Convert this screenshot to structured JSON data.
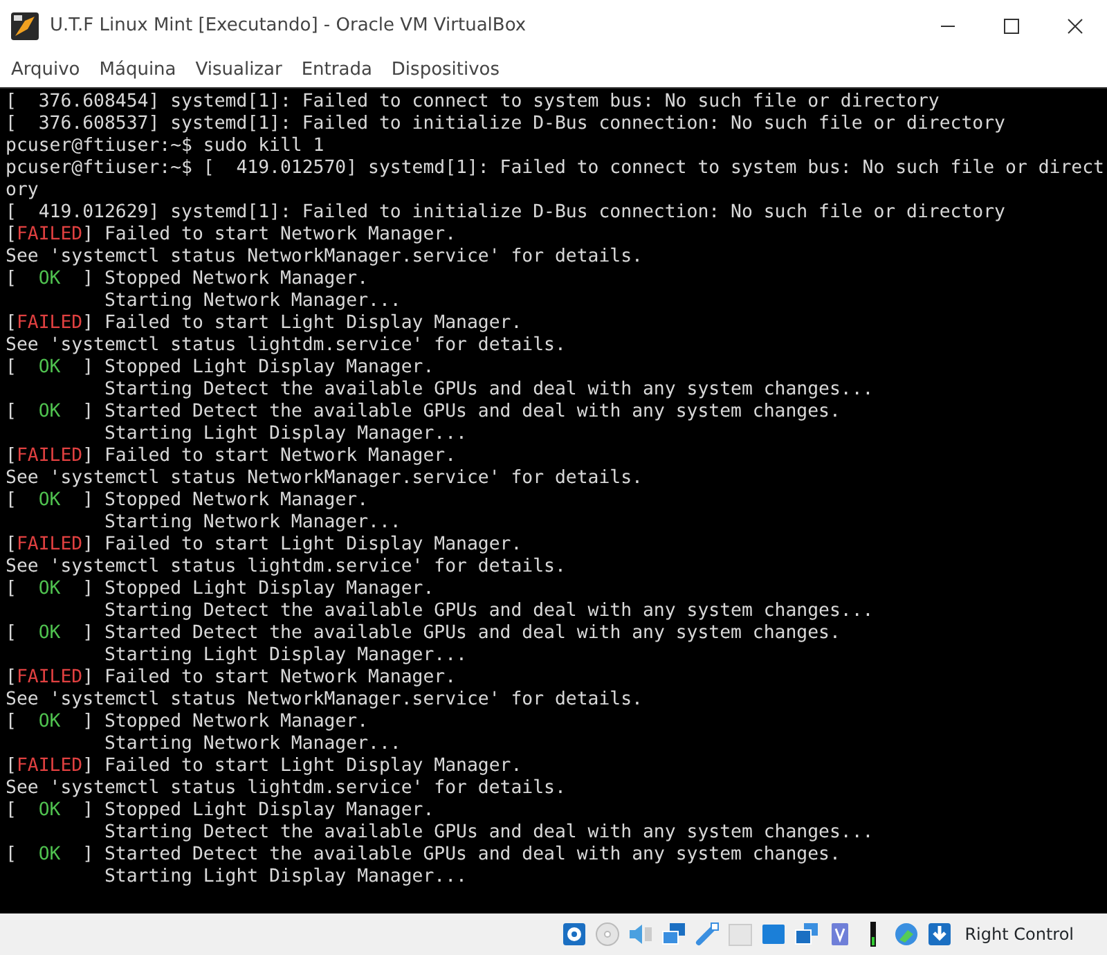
{
  "window": {
    "title": "U.T.F Linux Mint [Executando] - Oracle VM VirtualBox"
  },
  "menu": [
    "Arquivo",
    "Máquina",
    "Visualizar",
    "Entrada",
    "Dispositivos"
  ],
  "terminal": {
    "lines": [
      {
        "kind": "plain",
        "text": "[  376.608454] systemd[1]: Failed to connect to system bus: No such file or directory"
      },
      {
        "kind": "plain",
        "text": "[  376.608537] systemd[1]: Failed to initialize D-Bus connection: No such file or directory"
      },
      {
        "kind": "plain",
        "text": "pcuser@ftiuser:~$ sudo kill 1"
      },
      {
        "kind": "plain",
        "text": "pcuser@ftiuser:~$ [  419.012570] systemd[1]: Failed to connect to system bus: No such file or direct"
      },
      {
        "kind": "plain",
        "text": "ory"
      },
      {
        "kind": "plain",
        "text": "[  419.012629] systemd[1]: Failed to initialize D-Bus connection: No such file or directory"
      },
      {
        "kind": "failed",
        "pre": "[",
        "tag": "FAILED",
        "post": "] Failed to start Network Manager."
      },
      {
        "kind": "plain",
        "text": "See 'systemctl status NetworkManager.service' for details."
      },
      {
        "kind": "ok",
        "pre": "[  ",
        "tag": "OK",
        "post": "  ] Stopped Network Manager."
      },
      {
        "kind": "plain",
        "text": "         Starting Network Manager..."
      },
      {
        "kind": "failed",
        "pre": "[",
        "tag": "FAILED",
        "post": "] Failed to start Light Display Manager."
      },
      {
        "kind": "plain",
        "text": "See 'systemctl status lightdm.service' for details."
      },
      {
        "kind": "ok",
        "pre": "[  ",
        "tag": "OK",
        "post": "  ] Stopped Light Display Manager."
      },
      {
        "kind": "plain",
        "text": "         Starting Detect the available GPUs and deal with any system changes..."
      },
      {
        "kind": "ok",
        "pre": "[  ",
        "tag": "OK",
        "post": "  ] Started Detect the available GPUs and deal with any system changes."
      },
      {
        "kind": "plain",
        "text": "         Starting Light Display Manager..."
      },
      {
        "kind": "failed",
        "pre": "[",
        "tag": "FAILED",
        "post": "] Failed to start Network Manager."
      },
      {
        "kind": "plain",
        "text": "See 'systemctl status NetworkManager.service' for details."
      },
      {
        "kind": "ok",
        "pre": "[  ",
        "tag": "OK",
        "post": "  ] Stopped Network Manager."
      },
      {
        "kind": "plain",
        "text": "         Starting Network Manager..."
      },
      {
        "kind": "failed",
        "pre": "[",
        "tag": "FAILED",
        "post": "] Failed to start Light Display Manager."
      },
      {
        "kind": "plain",
        "text": "See 'systemctl status lightdm.service' for details."
      },
      {
        "kind": "ok",
        "pre": "[  ",
        "tag": "OK",
        "post": "  ] Stopped Light Display Manager."
      },
      {
        "kind": "plain",
        "text": "         Starting Detect the available GPUs and deal with any system changes..."
      },
      {
        "kind": "ok",
        "pre": "[  ",
        "tag": "OK",
        "post": "  ] Started Detect the available GPUs and deal with any system changes."
      },
      {
        "kind": "plain",
        "text": "         Starting Light Display Manager..."
      },
      {
        "kind": "failed",
        "pre": "[",
        "tag": "FAILED",
        "post": "] Failed to start Network Manager."
      },
      {
        "kind": "plain",
        "text": "See 'systemctl status NetworkManager.service' for details."
      },
      {
        "kind": "ok",
        "pre": "[  ",
        "tag": "OK",
        "post": "  ] Stopped Network Manager."
      },
      {
        "kind": "plain",
        "text": "         Starting Network Manager..."
      },
      {
        "kind": "failed",
        "pre": "[",
        "tag": "FAILED",
        "post": "] Failed to start Light Display Manager."
      },
      {
        "kind": "plain",
        "text": "See 'systemctl status lightdm.service' for details."
      },
      {
        "kind": "ok",
        "pre": "[  ",
        "tag": "OK",
        "post": "  ] Stopped Light Display Manager."
      },
      {
        "kind": "plain",
        "text": "         Starting Detect the available GPUs and deal with any system changes..."
      },
      {
        "kind": "ok",
        "pre": "[  ",
        "tag": "OK",
        "post": "  ] Started Detect the available GPUs and deal with any system changes."
      },
      {
        "kind": "plain",
        "text": "         Starting Light Display Manager..."
      }
    ]
  },
  "status_bar": {
    "host_key": "Right Control"
  }
}
